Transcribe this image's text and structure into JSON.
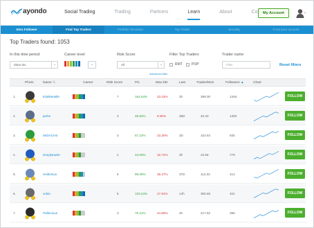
{
  "brand": {
    "name": "ayondo",
    "accent": "#1a8fd1",
    "green": "#4cae2e"
  },
  "nav": {
    "items": [
      {
        "label": "Social Trading",
        "dark": true
      },
      {
        "label": "Trading"
      },
      {
        "label": "Partners"
      },
      {
        "label": "Learn",
        "active": true
      },
      {
        "label": "About"
      },
      {
        "label": "Contact"
      }
    ],
    "account_label": "My Account",
    "avatar_icon": "user-silhouette-icon"
  },
  "subnav": {
    "items": [
      {
        "label": "Intro Follower",
        "state": "bold"
      },
      {
        "label": "Find Top Traders",
        "state": "on"
      },
      {
        "label": "Portfolio Simulator"
      },
      {
        "label": "Top Trader"
      },
      {
        "label": "Security"
      },
      {
        "label": "Fund your account"
      }
    ]
  },
  "filters": {
    "found_text": "Top Traders found: 1053",
    "period_label": "In this time period",
    "period_value": "Since inc.",
    "career_label": "Career level",
    "risk_label": "Risk Score",
    "risk_value": "All",
    "filter_label": "Filter Top Traders",
    "rmt_label": "RMT",
    "pop_label": "POP",
    "trader_label": "Trader name",
    "trader_placeholder": "Filter",
    "advanced_label": "Advanced filter",
    "reset_label": "Reset filters"
  },
  "table": {
    "headers": {
      "photo": "Photo",
      "name": "Name",
      "career": "Career",
      "risk": "Risk Score",
      "pl": "P/L",
      "maxdd": "Max DD",
      "last": "Last",
      "trades": "Trades/Mon",
      "followers": "Followers",
      "chart": "Chart"
    },
    "follow_label": "FOLLOW",
    "rows": [
      {
        "rank": "1.",
        "name": "EdelMetalle",
        "risk": "7",
        "pl": "164.64%",
        "maxdd": "23.33%",
        "last": "3h",
        "trades": "399.00",
        "followers": "1346"
      },
      {
        "rank": "2.",
        "name": "janhe",
        "risk": "3",
        "pl": "46.92%",
        "maxdd": "9.00%",
        "last": "38D",
        "trades": "40.40",
        "followers": "1300"
      },
      {
        "rank": "3.",
        "name": "MrDACHS",
        "risk": "3",
        "pl": "57.22%",
        "maxdd": "23.30%",
        "last": "2D",
        "trades": "102.84",
        "followers": "935"
      },
      {
        "rank": "4.",
        "name": "simplytrader",
        "risk": "2",
        "pl": "43.00%",
        "maxdd": "16.72%",
        "last": "3h",
        "trades": "23.58",
        "followers": "779"
      },
      {
        "rank": "5.",
        "name": "Heilteinus",
        "risk": "6",
        "pl": "99.08%",
        "maxdd": "26.47%",
        "last": "37D",
        "trades": "113.33",
        "followers": "414"
      },
      {
        "rank": "6.",
        "name": "volan",
        "risk": "5",
        "pl": "103.24%",
        "maxdd": "17.91%",
        "last": "14h",
        "trades": "305.50",
        "followers": "401"
      },
      {
        "rank": "7.",
        "name": "Pallenious",
        "risk": "3",
        "pl": "75.31%",
        "maxdd": "24.86%",
        "last": "2h",
        "trades": "217.62",
        "followers": "399"
      }
    ]
  }
}
